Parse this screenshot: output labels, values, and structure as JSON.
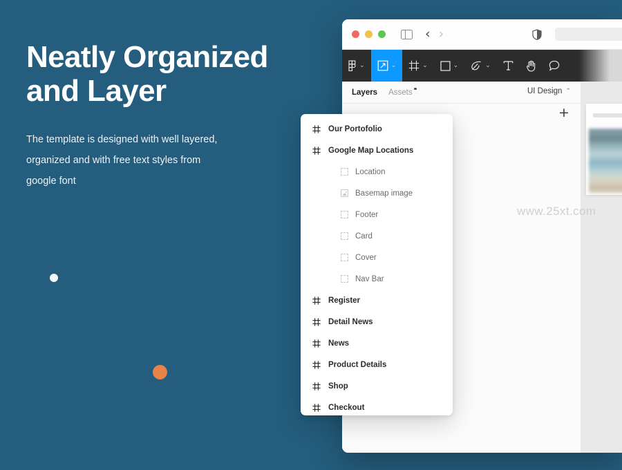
{
  "hero": {
    "title": "Neatly Organized\nand Layer",
    "subtitle": "The template is designed with well layered,\norganized and with free text styles from\ngoogle font"
  },
  "colors": {
    "background": "#245d7d",
    "accent_orange": "#e8834a",
    "tool_active_blue": "#0d99ff",
    "toolbar_dark": "#2c2c2c"
  },
  "browser": {
    "traffic_lights": [
      "close-red",
      "minimize-yellow",
      "maximize-green"
    ],
    "sidebar_toggle": "sidebar-toggle-icon",
    "back": "‹",
    "forward": "›",
    "shield": "shield-icon",
    "address_value": "",
    "address_placeholder": ""
  },
  "toolbar": {
    "tools": [
      {
        "name": "figma-menu",
        "glyph": "figma-logo-icon",
        "chevron": "⌄",
        "active": false
      },
      {
        "name": "move-scale",
        "glyph": "scale-tool-icon",
        "chevron": "⌄",
        "active": true
      },
      {
        "name": "frame",
        "glyph": "frame-tool-icon",
        "chevron": "⌄",
        "active": false
      },
      {
        "name": "shape",
        "glyph": "rectangle-tool-icon",
        "chevron": "⌄",
        "active": false
      },
      {
        "name": "pen",
        "glyph": "pen-tool-icon",
        "chevron": "⌄",
        "active": false
      },
      {
        "name": "text",
        "glyph": "text-tool-icon",
        "chevron": "",
        "active": false
      },
      {
        "name": "hand",
        "glyph": "hand-tool-icon",
        "chevron": "",
        "active": false
      },
      {
        "name": "comment",
        "glyph": "comment-tool-icon",
        "chevron": "",
        "active": false
      }
    ]
  },
  "sidebar": {
    "tabs": [
      {
        "label": "Layers",
        "active": true,
        "badge": false
      },
      {
        "label": "Assets",
        "active": false,
        "badge": true
      }
    ],
    "page_name": "UI Design",
    "page_chevron": "⌃",
    "add_label": "+"
  },
  "layers_popover": {
    "items": [
      {
        "label": "Our Portofolio",
        "icon": "frame-icon",
        "child": false
      },
      {
        "label": "Google Map Locations",
        "icon": "frame-icon",
        "child": false
      },
      {
        "label": "Location",
        "icon": "group-icon",
        "child": true
      },
      {
        "label": "Basemap image",
        "icon": "image-icon",
        "child": true
      },
      {
        "label": "Footer",
        "icon": "group-icon",
        "child": true
      },
      {
        "label": "Card",
        "icon": "group-icon",
        "child": true
      },
      {
        "label": "Cover",
        "icon": "group-icon",
        "child": true
      },
      {
        "label": "Nav Bar",
        "icon": "group-icon",
        "child": true
      },
      {
        "label": "Register",
        "icon": "frame-icon",
        "child": false
      },
      {
        "label": "Detail News",
        "icon": "frame-icon",
        "child": false
      },
      {
        "label": "News",
        "icon": "frame-icon",
        "child": false
      },
      {
        "label": "Product Details",
        "icon": "frame-icon",
        "child": false
      },
      {
        "label": "Shop",
        "icon": "frame-icon",
        "child": false
      },
      {
        "label": "Checkout",
        "icon": "frame-icon",
        "child": false
      }
    ]
  },
  "background_layers": {
    "items": [
      {
        "label": "Product Details",
        "icon": "frame-icon"
      },
      {
        "label": "Shop",
        "icon": "frame-icon"
      }
    ]
  },
  "canvas": {
    "watermark": "www.25xt.com"
  }
}
